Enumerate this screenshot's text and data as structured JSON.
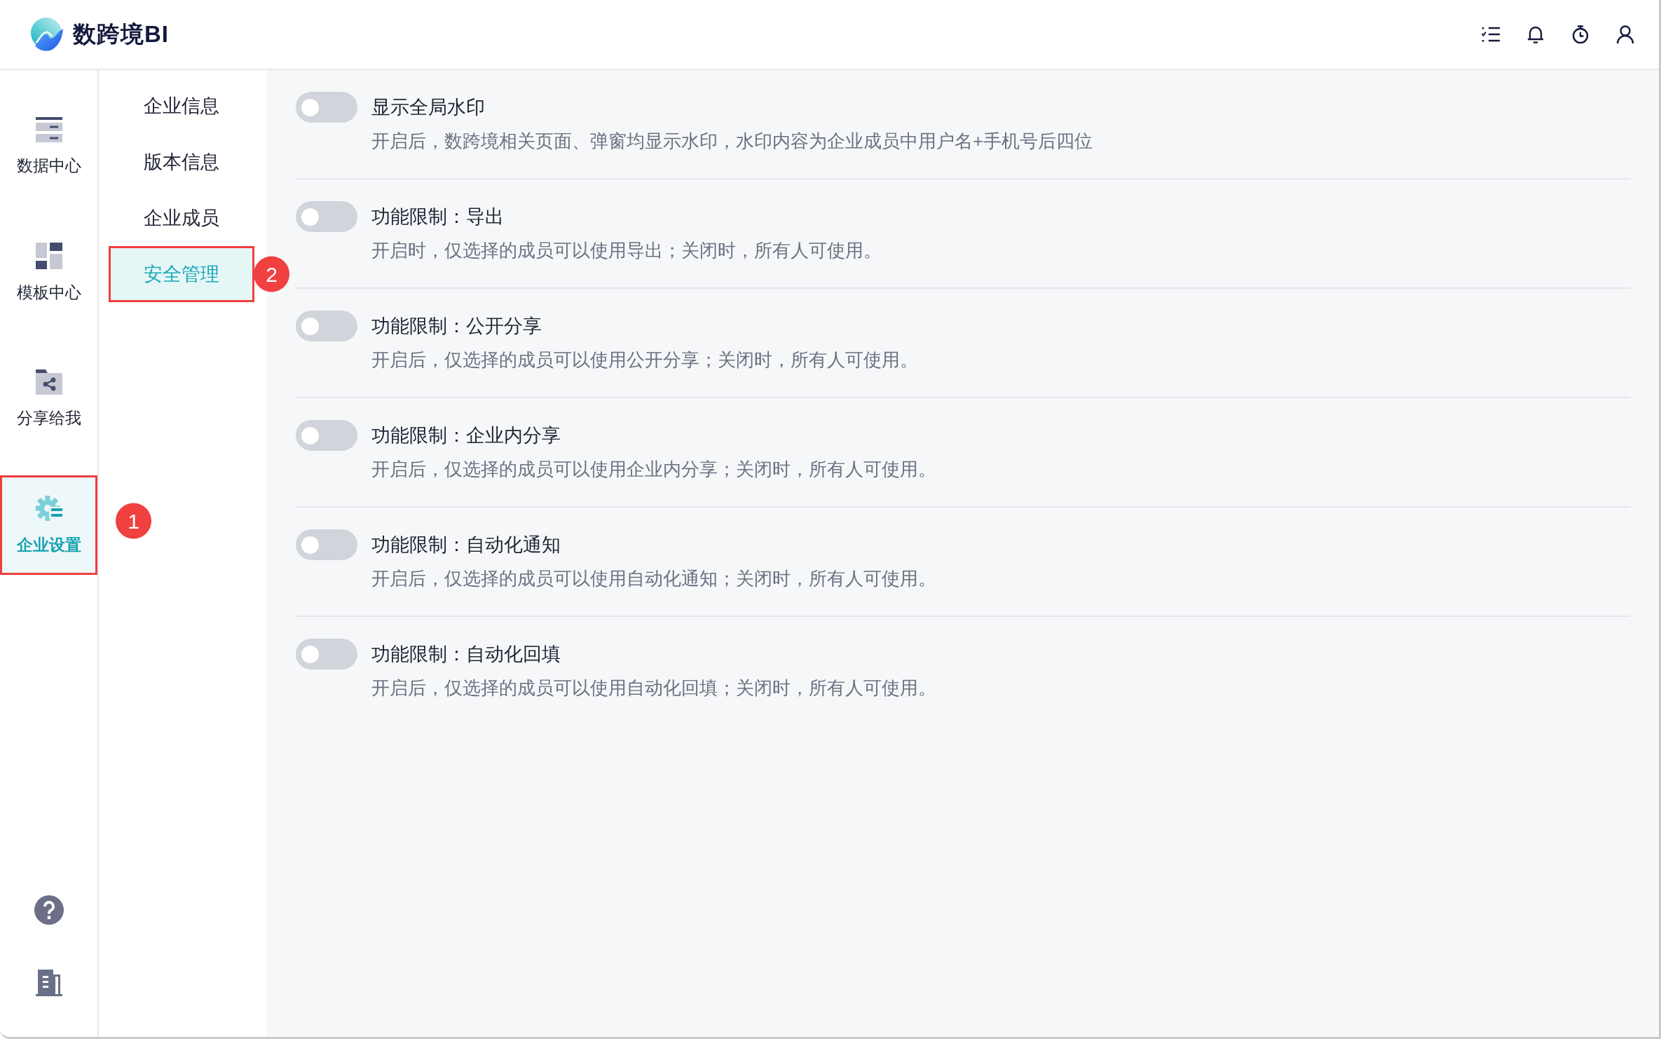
{
  "header": {
    "brand": "数跨境BI"
  },
  "rail": {
    "items": [
      {
        "label": "数据中心",
        "selected": false
      },
      {
        "label": "模板中心",
        "selected": false
      },
      {
        "label": "分享给我",
        "selected": false
      },
      {
        "label": "企业设置",
        "selected": true,
        "callout": "1"
      }
    ]
  },
  "settings_menu": {
    "items": [
      {
        "label": "企业信息",
        "selected": false
      },
      {
        "label": "版本信息",
        "selected": false
      },
      {
        "label": "企业成员",
        "selected": false
      },
      {
        "label": "安全管理",
        "selected": true,
        "callout": "2"
      }
    ]
  },
  "settings": [
    {
      "title": "显示全局水印",
      "description": "开启后，数跨境相关页面、弹窗均显示水印，水印内容为企业成员中用户名+手机号后四位",
      "on": false
    },
    {
      "title": "功能限制：导出",
      "description": "开启时，仅选择的成员可以使用导出；关闭时，所有人可使用。",
      "on": false
    },
    {
      "title": "功能限制：公开分享",
      "description": "开启后，仅选择的成员可以使用公开分享；关闭时，所有人可使用。",
      "on": false
    },
    {
      "title": "功能限制：企业内分享",
      "description": "开启后，仅选择的成员可以使用企业内分享；关闭时，所有人可使用。",
      "on": false
    },
    {
      "title": "功能限制：自动化通知",
      "description": "开启后，仅选择的成员可以使用自动化通知；关闭时，所有人可使用。",
      "on": false
    },
    {
      "title": "功能限制：自动化回填",
      "description": "开启后，仅选择的成员可以使用自动化回填；关闭时，所有人可使用。",
      "on": false
    }
  ]
}
